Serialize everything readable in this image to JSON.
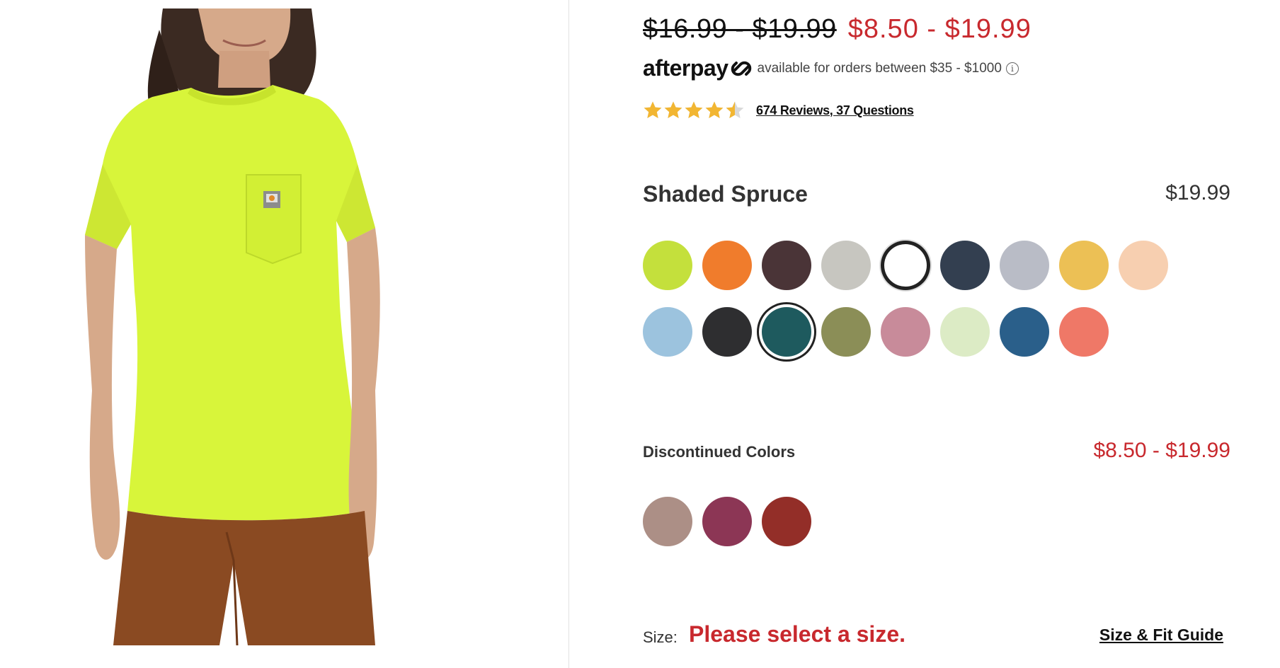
{
  "pricing": {
    "original": "$16.99 - $19.99",
    "sale": "$8.50 - $19.99"
  },
  "afterpay": {
    "logo_text": "afterpay",
    "logo_icon": "afterpay-arrows-icon",
    "message": "available for orders between $35 - $1000",
    "info_icon": "info-icon",
    "info_glyph": "i"
  },
  "rating": {
    "stars": 4.5,
    "reviews_link": "674 Reviews, 37 Questions",
    "star_color": "#f2b632"
  },
  "selected_color": {
    "name": "Shaded Spruce",
    "price": "$19.99"
  },
  "swatches": [
    {
      "name": "brite-lime",
      "color": "#c4e03c",
      "state": "normal"
    },
    {
      "name": "orange",
      "color": "#f07c2c",
      "state": "normal"
    },
    {
      "name": "dark-brown",
      "color": "#4a3437",
      "state": "normal"
    },
    {
      "name": "light-grey",
      "color": "#c7c6c0",
      "state": "normal"
    },
    {
      "name": "white",
      "color": "#ffffff",
      "state": "ring"
    },
    {
      "name": "navy",
      "color": "#333f50",
      "state": "normal"
    },
    {
      "name": "silver-grey",
      "color": "#b9bcc6",
      "state": "normal"
    },
    {
      "name": "gold-heather",
      "color": "#ecc055",
      "state": "normal"
    },
    {
      "name": "peach",
      "color": "#f7cfb0",
      "state": "normal"
    },
    {
      "name": "light-blue-heather",
      "color": "#9cc3de",
      "state": "normal"
    },
    {
      "name": "black",
      "color": "#2e2e30",
      "state": "normal"
    },
    {
      "name": "shaded-spruce",
      "color": "#1e5a5e",
      "state": "selected"
    },
    {
      "name": "olive",
      "color": "#8b8e57",
      "state": "normal"
    },
    {
      "name": "rose-heather",
      "color": "#c88b9a",
      "state": "normal"
    },
    {
      "name": "mint",
      "color": "#dcebc5",
      "state": "normal"
    },
    {
      "name": "blue",
      "color": "#2a5f8a",
      "state": "normal"
    },
    {
      "name": "coral",
      "color": "#ef7867",
      "state": "normal"
    }
  ],
  "discontinued": {
    "label": "Discontinued Colors",
    "price": "$8.50 - $19.99",
    "swatches": [
      {
        "name": "mauve",
        "color": "#ac8f86"
      },
      {
        "name": "berry",
        "color": "#8c3655"
      },
      {
        "name": "brick-red",
        "color": "#932e28"
      }
    ]
  },
  "size": {
    "label": "Size:",
    "warning": "Please select a size.",
    "guide_link": "Size & Fit Guide"
  },
  "colors": {
    "accent_red": "#c8292e",
    "product_shirt": "#d8f53a",
    "product_pants": "#8a4a22"
  }
}
